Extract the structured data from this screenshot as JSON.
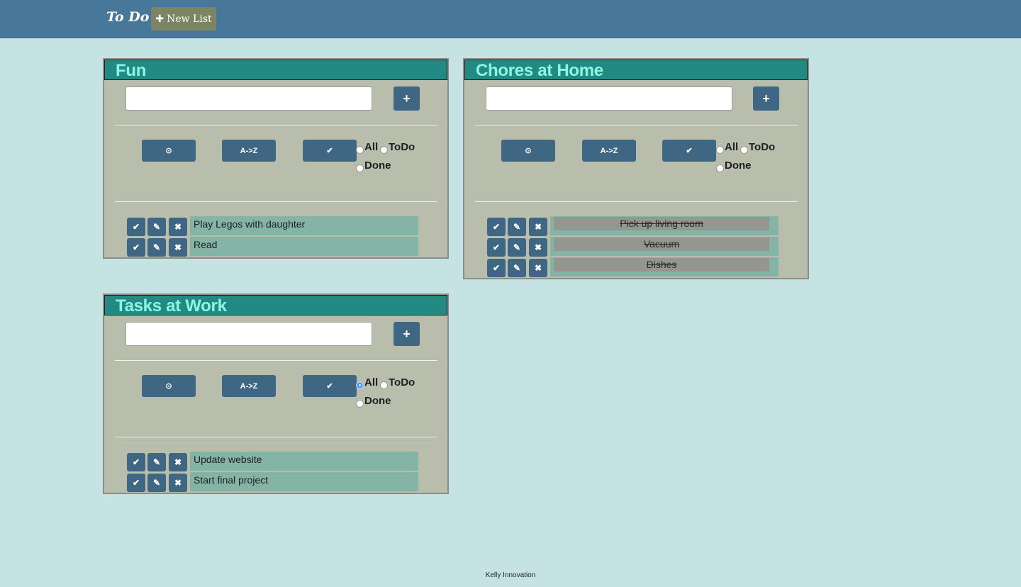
{
  "navbar": {
    "brand": "To Do",
    "new_list_icon": "plus-icon",
    "new_list_label": "New List"
  },
  "sort_buttons": {
    "time_icon": "clock-icon",
    "alpha_label": "A->Z",
    "done_icon": "check-icon"
  },
  "filter_labels": {
    "all": "All",
    "todo": "ToDo",
    "done": "Done"
  },
  "item_actions": [
    "check-icon",
    "pencil-icon",
    "close-icon"
  ],
  "lists": [
    {
      "title": "Fun",
      "filter": "none",
      "items": [
        {
          "text": "Play Legos with daughter",
          "done": false
        },
        {
          "text": "Read",
          "done": false
        }
      ]
    },
    {
      "title": "Chores at Home",
      "filter": "none",
      "items": [
        {
          "text": "Pick up living room",
          "done": true
        },
        {
          "text": "Vacuum",
          "done": true
        },
        {
          "text": "Dishes",
          "done": true
        }
      ]
    },
    {
      "title": "Tasks at Work",
      "filter": "all",
      "items": [
        {
          "text": "Update website",
          "done": false
        },
        {
          "text": "Start final project",
          "done": false
        }
      ]
    }
  ],
  "footer": "Kelly Innovation",
  "colors": {
    "page_bg": "#c5e3e3",
    "navbar": "#47789a",
    "card_bg": "#b9bdac",
    "header": "#238a83",
    "title": "#8ff4e4",
    "button": "#3f6784",
    "item_bg": "#84b4a6",
    "done_bg": "#94978f"
  }
}
